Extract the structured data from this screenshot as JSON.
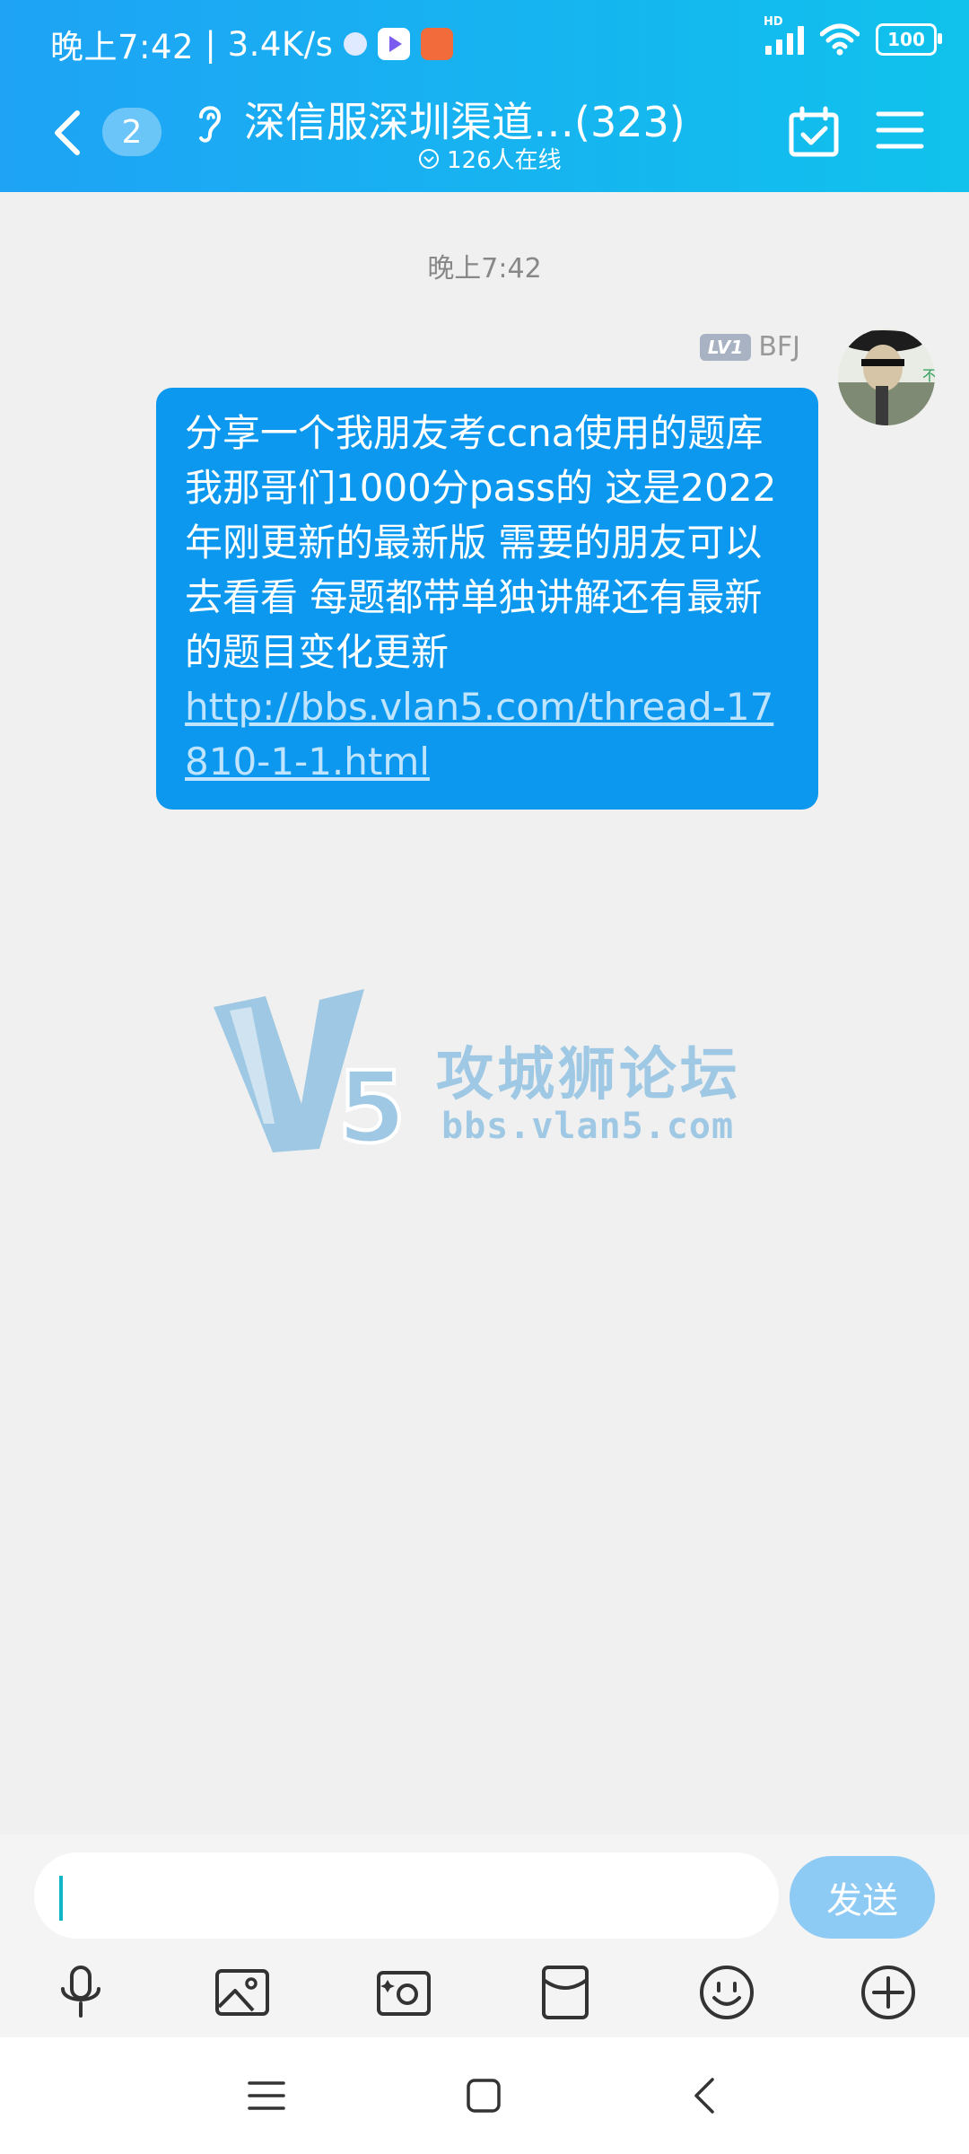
{
  "status": {
    "time": "晚上7:42",
    "speed": "3.4K/s",
    "battery": "100"
  },
  "header": {
    "unread_count": "2",
    "title": "深信服深圳渠道…(323)",
    "online": "126人在线"
  },
  "chat": {
    "timestamp": "晚上7:42",
    "message": {
      "level": "LV1",
      "sender": "BFJ",
      "text": "分享一个我朋友考ccna使用的题库 我那哥们1000分pass的 这是2022年刚更新的最新版 需要的朋友可以去看看 每题都带单独讲解还有最新的题目变化更新",
      "link": "http://bbs.vlan5.com/thread-17810-1-1.html"
    },
    "watermark": {
      "title": "攻城狮论坛",
      "url": "bbs.vlan5.com"
    }
  },
  "input": {
    "value": "",
    "send_label": "发送"
  },
  "toolbar": [
    "mic-icon",
    "image-icon",
    "camera-icon",
    "red-packet-icon",
    "emoji-icon",
    "plus-icon"
  ],
  "colors": {
    "header_start": "#1ea3f5",
    "header_end": "#10c2ec",
    "bubble": "#0b98ee",
    "send": "#8dcaf4",
    "background": "#f0f0f0"
  }
}
